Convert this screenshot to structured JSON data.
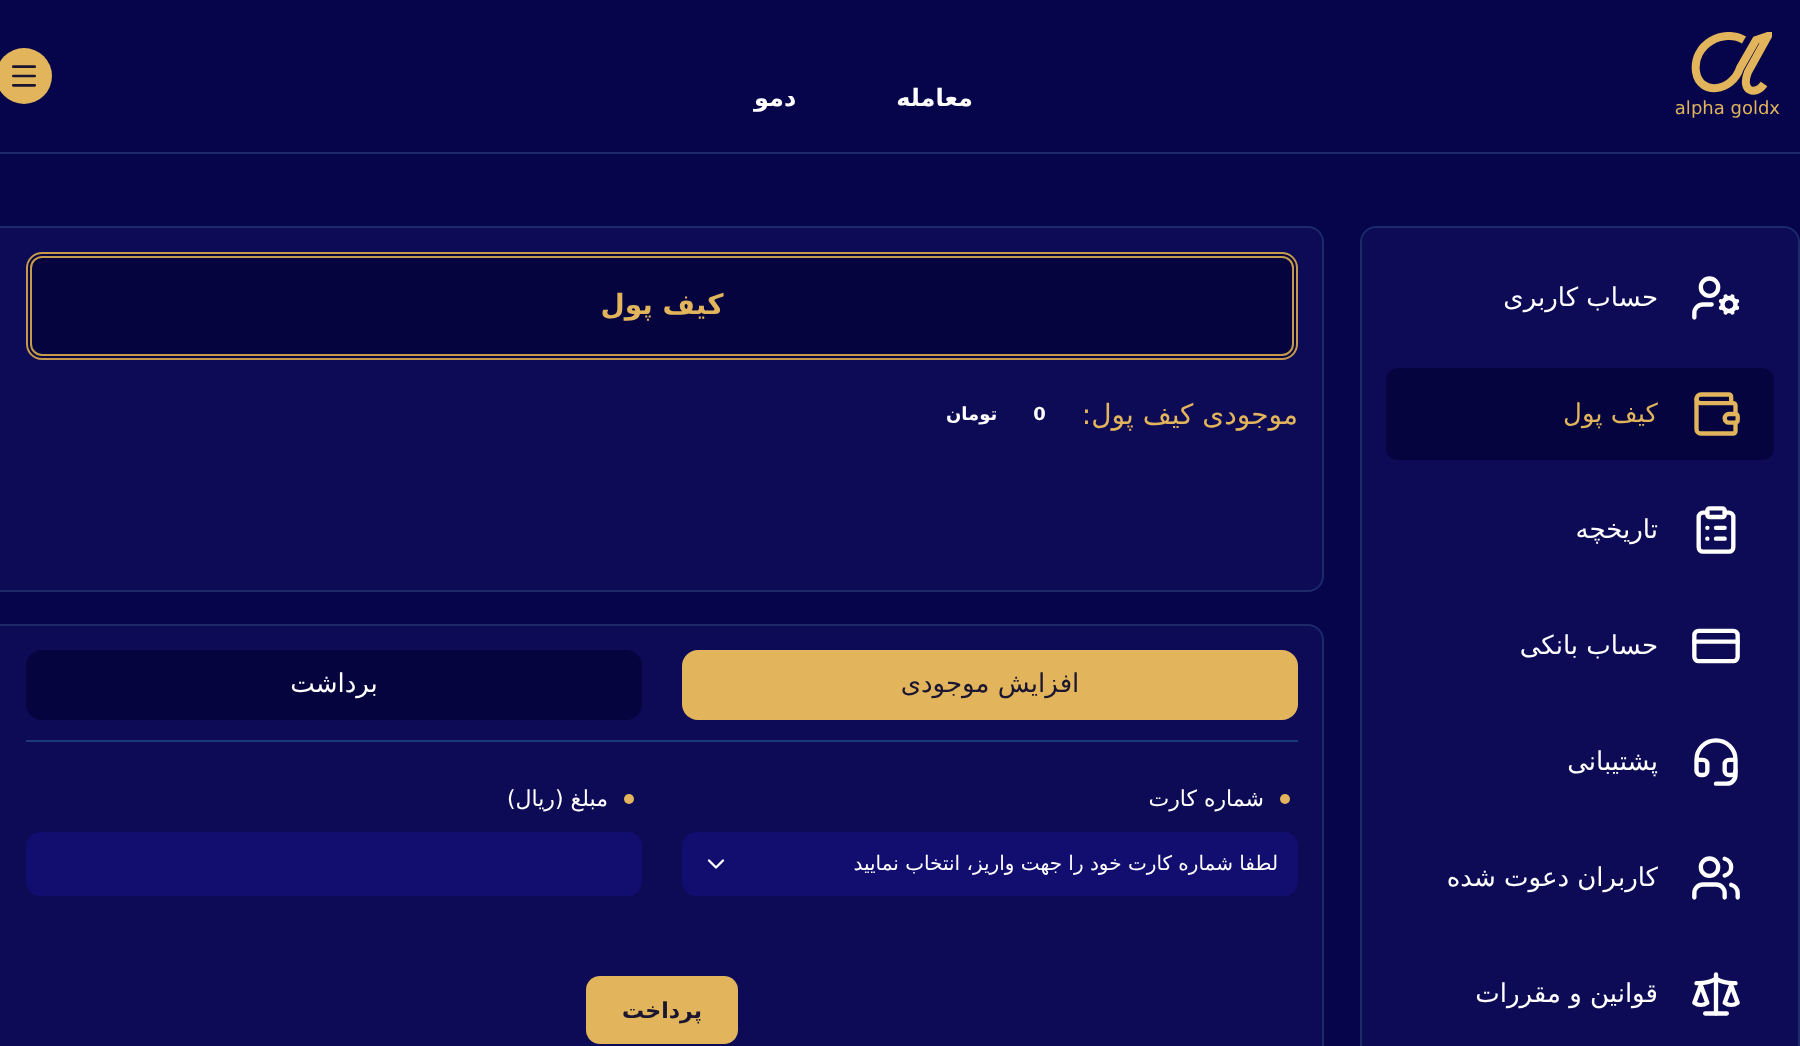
{
  "header": {
    "logo_text": "alpha goldx",
    "nav": [
      {
        "label": "معامله"
      },
      {
        "label": "دمو"
      }
    ]
  },
  "sidebar": {
    "items": [
      {
        "kind": "user",
        "label": "حساب کاربری",
        "selected": false
      },
      {
        "kind": "wallet",
        "label": "کیف پول",
        "selected": true
      },
      {
        "kind": "history",
        "label": "تاریخچه",
        "selected": false
      },
      {
        "kind": "card",
        "label": "حساب بانکی",
        "selected": false
      },
      {
        "kind": "support",
        "label": "پشتیبانی",
        "selected": false
      },
      {
        "kind": "users",
        "label": "کاربران دعوت شده",
        "selected": false
      },
      {
        "kind": "rules",
        "label": "قوانین و مقررات",
        "selected": false
      }
    ]
  },
  "wallet": {
    "title": "کیف پول",
    "balance_label": "موجودی کیف پول:",
    "balance_value": "0",
    "balance_unit": "تومان"
  },
  "form": {
    "tabs": [
      {
        "label": "افزایش موجودی",
        "selected": true
      },
      {
        "label": "برداشت",
        "selected": false
      }
    ],
    "fields": [
      {
        "kind": "select",
        "label": "شماره کارت",
        "placeholder": "لطفا شماره کارت خود را جهت واریز، انتخاب نمایید"
      },
      {
        "kind": "input",
        "label": "مبلغ (ریال)"
      }
    ],
    "submit": "پرداخت"
  }
}
